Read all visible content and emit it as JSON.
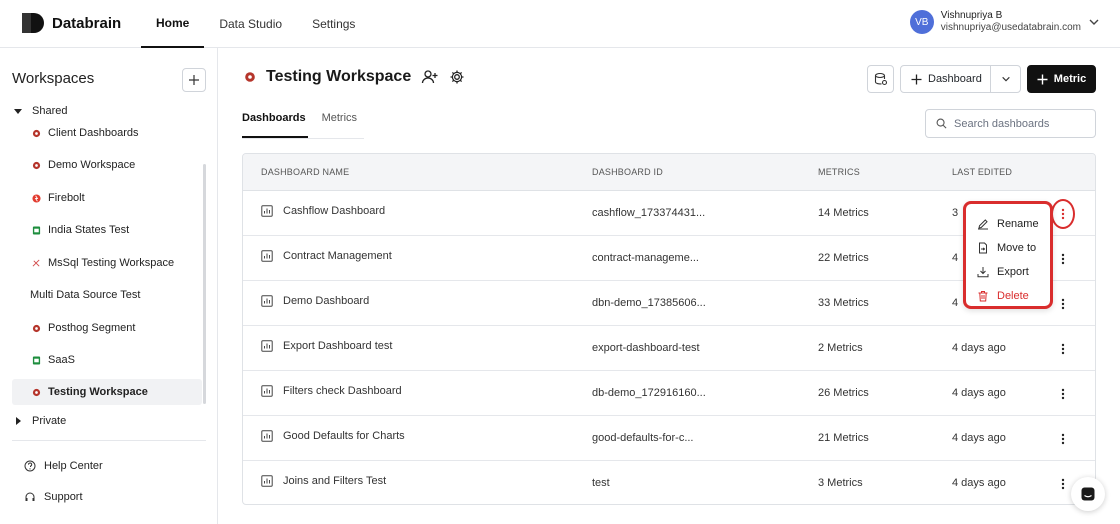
{
  "app": {
    "name": "Databrain"
  },
  "nav": [
    {
      "label": "Home",
      "active": true
    },
    {
      "label": "Data Studio"
    },
    {
      "label": "Settings"
    }
  ],
  "user": {
    "initials": "VB",
    "name": "Vishnupriya B",
    "email": "vishnupriya@usedatabrain.com"
  },
  "sidebar": {
    "title": "Workspaces",
    "shared_label": "Shared",
    "private_label": "Private",
    "items": [
      {
        "label": "Client Dashboards",
        "icon": "workspace-icon"
      },
      {
        "label": "Demo Workspace",
        "icon": "workspace-icon"
      },
      {
        "label": "Firebolt",
        "icon": "firebolt-icon"
      },
      {
        "label": "India States Test",
        "icon": "sheets-icon"
      },
      {
        "label": "MsSql Testing Workspace",
        "icon": "mssql-icon"
      },
      {
        "label": "Multi Data Source Test",
        "icon": ""
      },
      {
        "label": "Posthog Segment",
        "icon": "workspace-icon"
      },
      {
        "label": "SaaS",
        "icon": "sheets-icon"
      },
      {
        "label": "Testing Workspace",
        "icon": "workspace-icon",
        "selected": true
      }
    ],
    "help_label": "Help Center",
    "support_label": "Support"
  },
  "main": {
    "title": "Testing Workspace",
    "dashboard_button": "Dashboard",
    "metric_button": "Metric",
    "tabs": [
      {
        "label": "Dashboards",
        "active": true
      },
      {
        "label": "Metrics"
      }
    ],
    "search_placeholder": "Search dashboards",
    "columns": [
      "DASHBOARD NAME",
      "DASHBOARD ID",
      "METRICS",
      "LAST EDITED"
    ],
    "rows": [
      {
        "name": "Cashflow Dashboard",
        "id": "cashflow_173374431...",
        "metrics": "14 Metrics",
        "edited": "3"
      },
      {
        "name": "Contract Management",
        "id": "contract-manageme...",
        "metrics": "22 Metrics",
        "edited": "4"
      },
      {
        "name": "Demo Dashboard",
        "id": "dbn-demo_17385606...",
        "metrics": "33 Metrics",
        "edited": "4"
      },
      {
        "name": "Export Dashboard test",
        "id": "export-dashboard-test",
        "metrics": "2 Metrics",
        "edited": "4 days ago"
      },
      {
        "name": "Filters check Dashboard",
        "id": "db-demo_172916160...",
        "metrics": "26 Metrics",
        "edited": "4 days ago"
      },
      {
        "name": "Good Defaults for Charts",
        "id": "good-defaults-for-c...",
        "metrics": "21 Metrics",
        "edited": "4 days ago"
      },
      {
        "name": "Joins and Filters Test",
        "id": "test",
        "metrics": "3 Metrics",
        "edited": "4 days ago"
      }
    ],
    "context_menu": [
      {
        "label": "Rename",
        "icon": "pencil-icon"
      },
      {
        "label": "Move to",
        "icon": "file-move-icon"
      },
      {
        "label": "Export",
        "icon": "download-icon"
      },
      {
        "label": "Delete",
        "icon": "trash-icon",
        "danger": true
      }
    ]
  },
  "colors": {
    "accent_red": "#d92d2d",
    "avatar": "#4f6fd9",
    "workspace_icon": "#b5352b",
    "sheets_icon": "#1e8e3e"
  }
}
